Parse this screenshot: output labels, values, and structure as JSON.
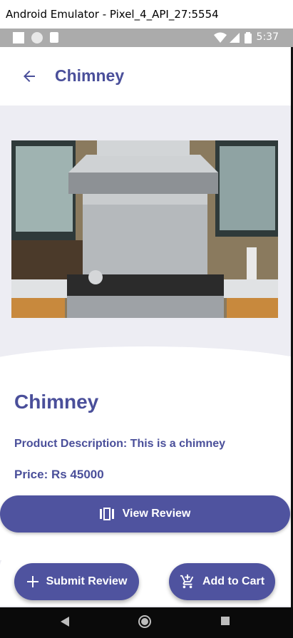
{
  "window": {
    "title": "Android Emulator - Pixel_4_API_27:5554"
  },
  "status_bar": {
    "time": "5:37"
  },
  "app_bar": {
    "title": "Chimney"
  },
  "product": {
    "name": "Chimney",
    "description": "Product Description: This is a chimney",
    "price": "Price: Rs 45000",
    "image_alt": "Stainless steel chimney hood above a gas stove"
  },
  "actions": {
    "view_review": "View Review",
    "submit_review": "Submit Review",
    "add_to_cart": "Add to Cart"
  },
  "colors": {
    "accent": "#4f539f",
    "title": "#4a4f9a",
    "background": "#ededf3"
  }
}
